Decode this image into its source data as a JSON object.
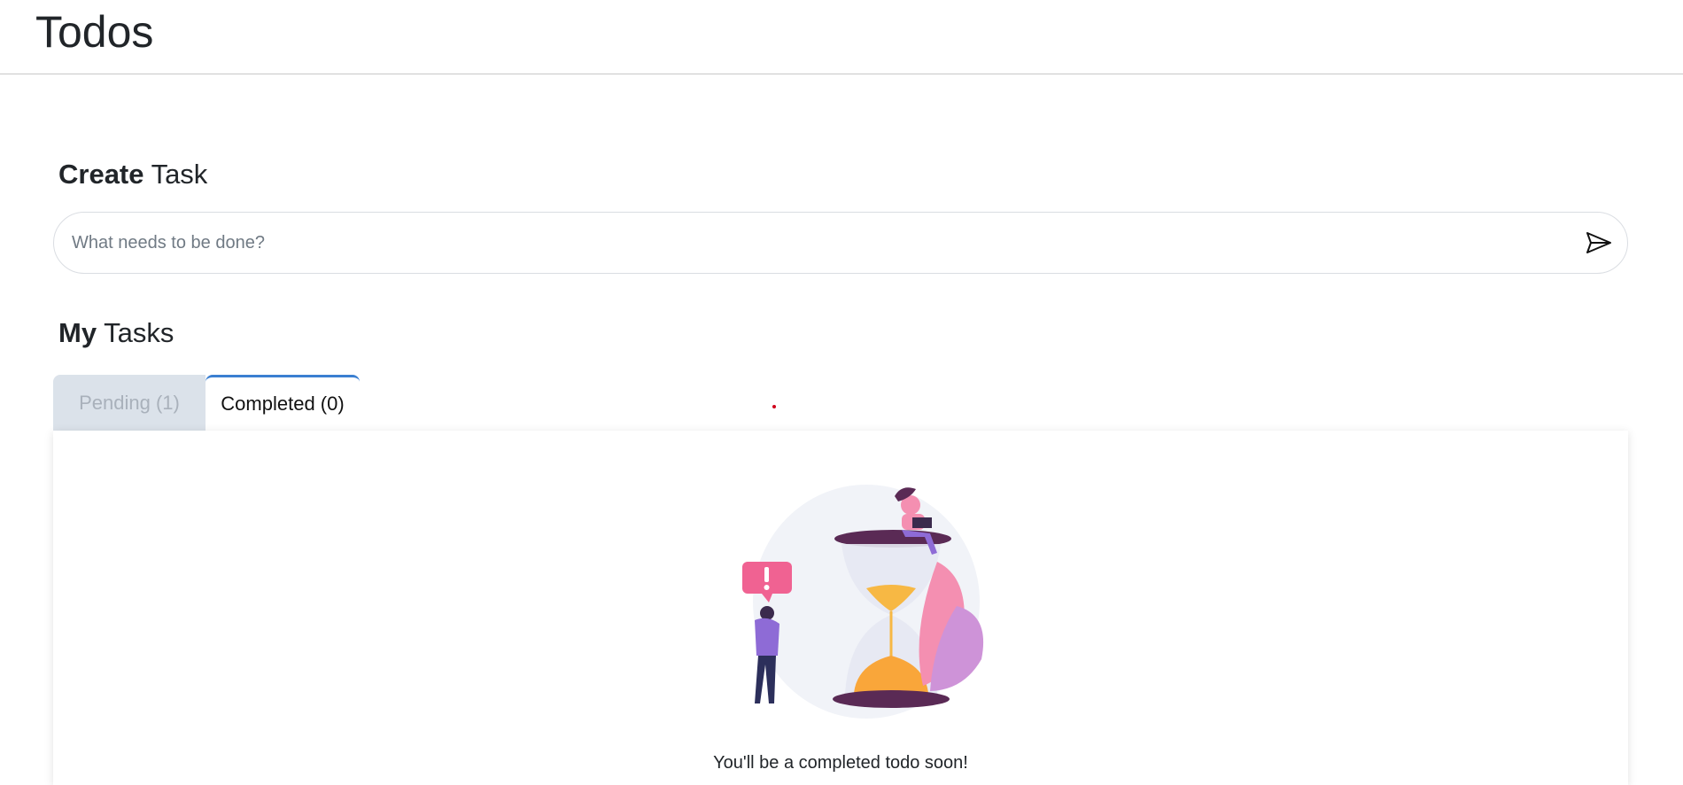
{
  "header": {
    "title": "Todos"
  },
  "create_section": {
    "title_bold": "Create",
    "title_rest": "Task",
    "input_placeholder": "What needs to be done?",
    "input_value": "",
    "send_icon": "paper-plane-icon"
  },
  "tasks_section": {
    "title_bold": "My",
    "title_rest": "Tasks",
    "tabs": [
      {
        "label": "Pending (1)",
        "active": false
      },
      {
        "label": "Completed (0)",
        "active": true
      }
    ],
    "empty_illustration": "hourglass-waiting-illustration",
    "empty_message": "You'll be a completed todo soon!"
  },
  "colors": {
    "active_tab_accent": "#3b7fd1",
    "inactive_tab_bg": "#dbe2ea",
    "inactive_tab_text": "#a9b1bb"
  }
}
